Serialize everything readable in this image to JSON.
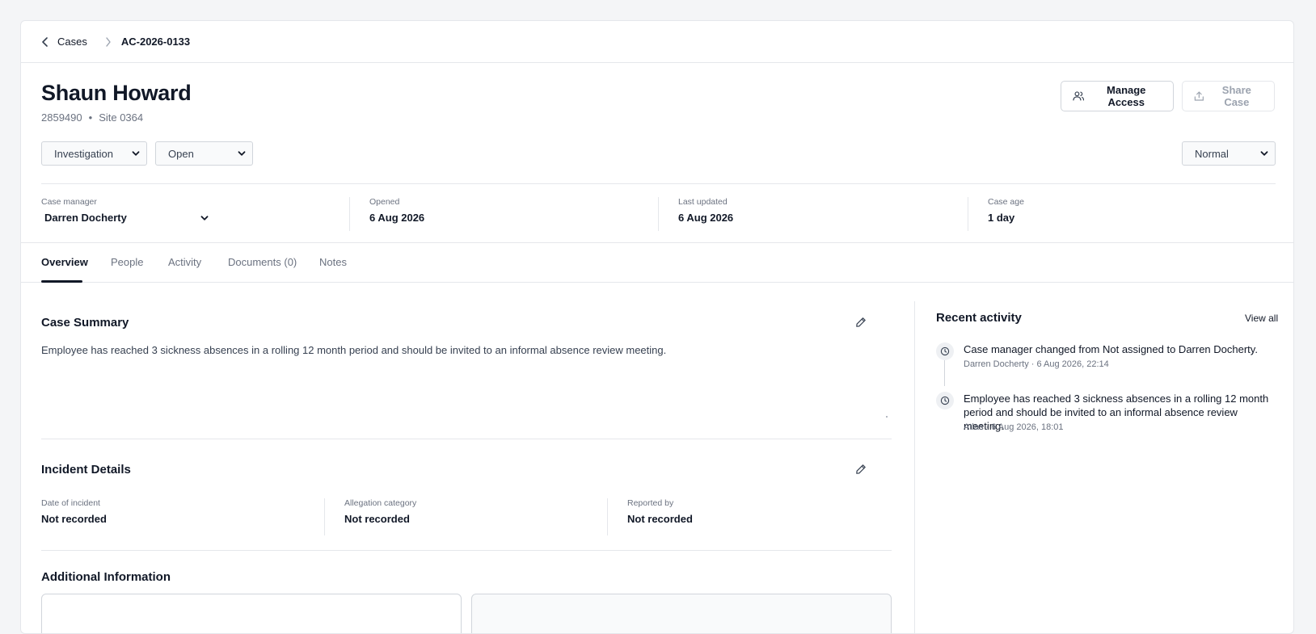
{
  "breadcrumb": {
    "back_label": "Cases",
    "current": "AC-2026-0133"
  },
  "header": {
    "name": "Shaun Howard",
    "employee_id": "2859490",
    "separator": "•",
    "site": "Site 0364",
    "manage_access_label": "Manage Access",
    "share_case_label": "Share Case"
  },
  "selects": {
    "type": "Investigation",
    "status": "Open",
    "priority": "Normal"
  },
  "stats": {
    "case_manager_label": "Case manager",
    "case_manager_value": "Darren Docherty",
    "opened_label": "Opened",
    "opened_value": "6 Aug 2026",
    "last_updated_label": "Last updated",
    "last_updated_value": "6 Aug 2026",
    "case_age_label": "Case age",
    "case_age_value": "1 day"
  },
  "tabs": [
    "Overview",
    "People",
    "Activity",
    "Documents (0)",
    "Notes"
  ],
  "summary": {
    "title": "Case Summary",
    "text": "Employee has reached 3 sickness absences in a rolling 12 month period and should be invited to an informal absence review meeting."
  },
  "incident": {
    "title": "Incident Details",
    "date_label": "Date of incident",
    "date_value": "Not recorded",
    "category_label": "Allegation category",
    "category_value": "Not recorded",
    "reported_label": "Reported by",
    "reported_value": "Not recorded"
  },
  "additional": {
    "title": "Additional Information"
  },
  "activity": {
    "title": "Recent activity",
    "view_all": "View all",
    "items": [
      {
        "text": "Case manager changed from Not assigned to Darren Docherty.",
        "meta": "Darren Docherty · 6 Aug 2026, 22:14"
      },
      {
        "text": "Employee has reached 3 sickness absences in a rolling 12 month period and should be invited to an informal absence review meeting.",
        "meta": "Atlas · 6 Aug 2026, 18:01"
      }
    ]
  },
  "icons": {
    "back": "chevron-left-icon",
    "crumb_sep": "chevron-right-icon",
    "manage_access": "users-icon",
    "share": "upload-icon",
    "edit": "pencil-icon",
    "activity": "clock-icon"
  }
}
